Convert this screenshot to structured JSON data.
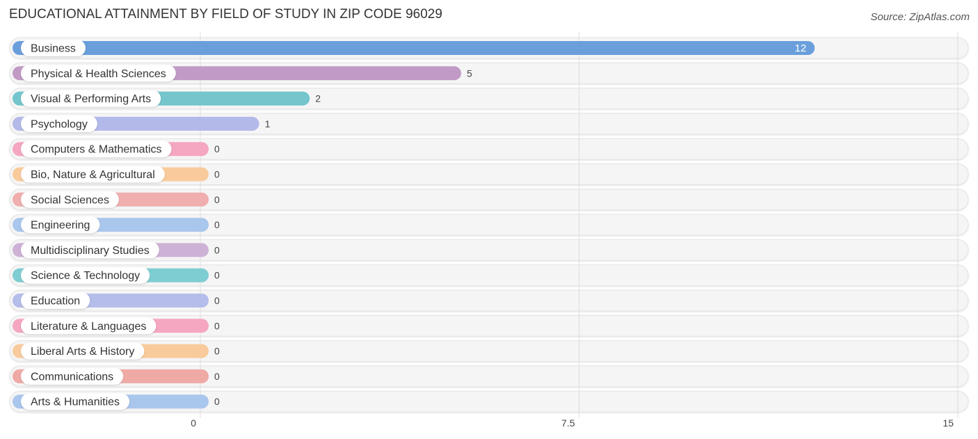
{
  "header": {
    "title": "EDUCATIONAL ATTAINMENT BY FIELD OF STUDY IN ZIP CODE 96029",
    "source": "Source: ZipAtlas.com"
  },
  "chart_data": {
    "type": "bar",
    "orientation": "horizontal",
    "title": "EDUCATIONAL ATTAINMENT BY FIELD OF STUDY IN ZIP CODE 96029",
    "xlabel": "",
    "ylabel": "",
    "xlim": [
      0,
      15
    ],
    "xticks": [
      0,
      7.5,
      15
    ],
    "xtick_labels": [
      "0",
      "7.5",
      "15"
    ],
    "grid": true,
    "legend": "none",
    "categories": [
      "Business",
      "Physical & Health Sciences",
      "Visual & Performing Arts",
      "Psychology",
      "Computers & Mathematics",
      "Bio, Nature & Agricultural",
      "Social Sciences",
      "Engineering",
      "Multidisciplinary Studies",
      "Science & Technology",
      "Education",
      "Literature & Languages",
      "Liberal Arts & History",
      "Communications",
      "Arts & Humanities"
    ],
    "values": [
      12,
      5,
      2,
      1,
      0,
      0,
      0,
      0,
      0,
      0,
      0,
      0,
      0,
      0,
      0
    ],
    "value_labels": [
      "12",
      "5",
      "2",
      "1",
      "0",
      "0",
      "0",
      "0",
      "0",
      "0",
      "0",
      "0",
      "0",
      "0",
      "0"
    ],
    "colors": [
      "#6a9fdb",
      "#c19ac6",
      "#74c5cc",
      "#b3b9e9",
      "#f5a6c0",
      "#f9cb9c",
      "#f0aeae",
      "#a9c6ec",
      "#cdb2d6",
      "#7ecdd2",
      "#b5bdea",
      "#f5a6c0",
      "#f9cb9c",
      "#efaaa6",
      "#a9c6ec"
    ]
  }
}
